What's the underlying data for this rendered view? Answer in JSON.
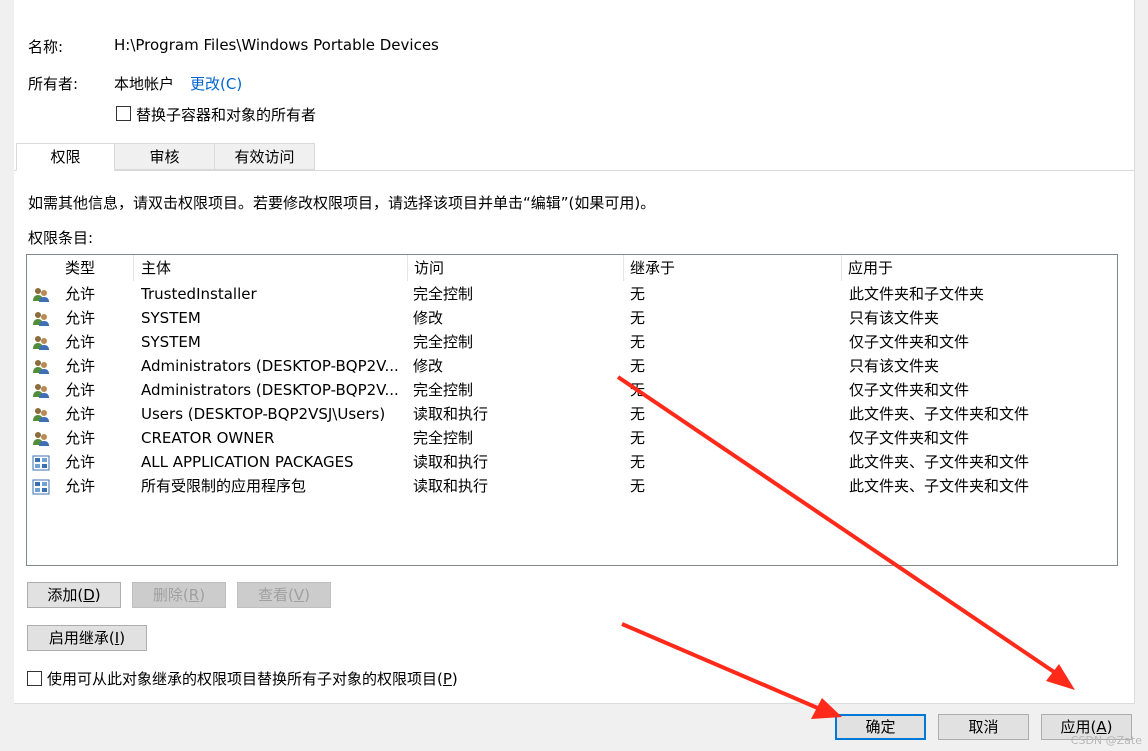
{
  "header": {
    "name_label": "名称:",
    "name_value": "H:\\Program Files\\Windows Portable Devices",
    "owner_label": "所有者:",
    "owner_value": "本地帐户",
    "change_link": "更改(C)",
    "replace_owner_checkbox": "替换子容器和对象的所有者"
  },
  "tabs": [
    {
      "label": "权限",
      "active": true
    },
    {
      "label": "审核",
      "active": false
    },
    {
      "label": "有效访问",
      "active": false
    }
  ],
  "info_text": "如需其他信息，请双击权限项目。若要修改权限项目，请选择该项目并单击“编辑”(如果可用)。",
  "entries_label": "权限条目:",
  "columns": [
    "类型",
    "主体",
    "访问",
    "继承于",
    "应用于"
  ],
  "rows": [
    {
      "icon": "users-icon",
      "type": "允许",
      "principal": "TrustedInstaller",
      "access": "完全控制",
      "inherited": "无",
      "applies": "此文件夹和子文件夹"
    },
    {
      "icon": "users-icon",
      "type": "允许",
      "principal": "SYSTEM",
      "access": "修改",
      "inherited": "无",
      "applies": "只有该文件夹"
    },
    {
      "icon": "users-icon",
      "type": "允许",
      "principal": "SYSTEM",
      "access": "完全控制",
      "inherited": "无",
      "applies": "仅子文件夹和文件"
    },
    {
      "icon": "users-icon",
      "type": "允许",
      "principal": "Administrators (DESKTOP-BQP2V...",
      "access": "修改",
      "inherited": "无",
      "applies": "只有该文件夹"
    },
    {
      "icon": "users-icon",
      "type": "允许",
      "principal": "Administrators (DESKTOP-BQP2V...",
      "access": "完全控制",
      "inherited": "无",
      "applies": "仅子文件夹和文件"
    },
    {
      "icon": "users-icon",
      "type": "允许",
      "principal": "Users (DESKTOP-BQP2VSJ\\Users)",
      "access": "读取和执行",
      "inherited": "无",
      "applies": "此文件夹、子文件夹和文件"
    },
    {
      "icon": "users-icon",
      "type": "允许",
      "principal": "CREATOR OWNER",
      "access": "完全控制",
      "inherited": "无",
      "applies": "仅子文件夹和文件"
    },
    {
      "icon": "app-package-icon",
      "type": "允许",
      "principal": "ALL APPLICATION PACKAGES",
      "access": "读取和执行",
      "inherited": "无",
      "applies": "此文件夹、子文件夹和文件"
    },
    {
      "icon": "app-package-icon",
      "type": "允许",
      "principal": "所有受限制的应用程序包",
      "access": "读取和执行",
      "inherited": "无",
      "applies": "此文件夹、子文件夹和文件"
    }
  ],
  "buttons": {
    "add": {
      "text": "添加",
      "key": "D"
    },
    "remove": {
      "text": "删除",
      "key": "R"
    },
    "view": {
      "text": "查看",
      "key": "V"
    },
    "inherit": {
      "text": "启用继承",
      "key": "I"
    }
  },
  "replace_child_checkbox": {
    "text": "使用可从此对象继承的权限项目替换所有子对象的权限项目",
    "key": "P"
  },
  "footer": {
    "ok": "确定",
    "cancel": "取消",
    "apply": {
      "text": "应用",
      "key": "A"
    }
  },
  "watermark": "CSDN @Zate",
  "colors": {
    "link": "#0066cc",
    "annotation_arrow": "#ff2a1a",
    "default_button_border": "#0078d7"
  }
}
